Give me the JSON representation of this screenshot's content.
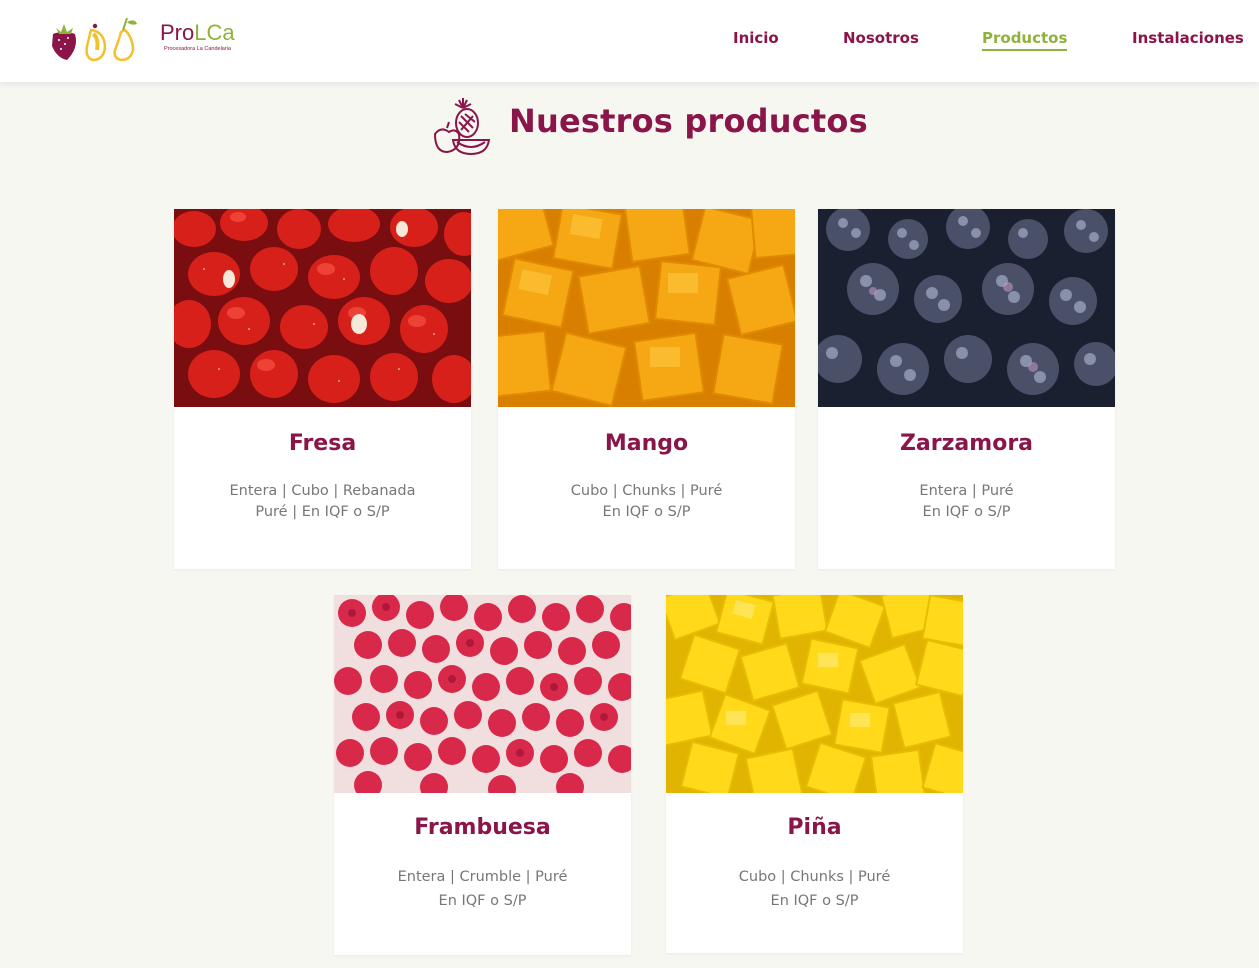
{
  "brand": {
    "name_part1": "Pro",
    "name_part2": "LCa",
    "tagline": "Procesadora La Candelaria",
    "colors": {
      "primary": "#8a1549",
      "accent": "#8fb339"
    }
  },
  "nav": {
    "items": [
      {
        "label": "Inicio",
        "active": false
      },
      {
        "label": "Nosotros",
        "active": false
      },
      {
        "label": "Productos",
        "active": true
      },
      {
        "label": "Instalaciones",
        "active": false
      }
    ]
  },
  "section": {
    "title": "Nuestros productos",
    "icon": "fruit-basket-icon"
  },
  "products": [
    {
      "name": "Fresa",
      "line1": "Entera | Cubo | Rebanada",
      "line2": "Puré | En IQF o S/P",
      "image": "strawberries"
    },
    {
      "name": "Mango",
      "line1": "Cubo | Chunks | Puré",
      "line2": "En IQF o S/P",
      "image": "mango-cubes"
    },
    {
      "name": "Zarzamora",
      "line1": "Entera | Puré",
      "line2": "En IQF o S/P",
      "image": "frozen-blackberries"
    },
    {
      "name": "Frambuesa",
      "line1": "Entera | Crumble | Puré",
      "line2": "En IQF o S/P",
      "image": "raspberries"
    },
    {
      "name": "Piña",
      "line1": "Cubo | Chunks | Puré",
      "line2": "En IQF o S/P",
      "image": "pineapple-chunks"
    }
  ]
}
